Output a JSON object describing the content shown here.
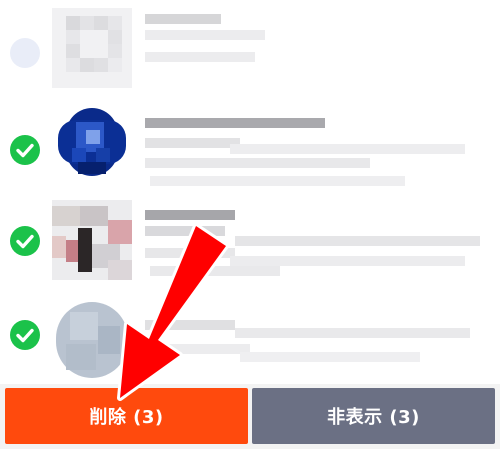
{
  "rows": [
    {
      "selected": false
    },
    {
      "selected": true
    },
    {
      "selected": true
    },
    {
      "selected": true
    }
  ],
  "actions": {
    "delete_label": "削除 (3)",
    "hide_label": "非表示 (3)"
  },
  "colors": {
    "delete": "#ff4a0d",
    "hide": "#6b7084",
    "check": "#1bc24a",
    "arrow": "#ff0000"
  },
  "icons": {
    "check": "checkmark-circle",
    "unchecked": "empty-circle",
    "annotation": "red-arrow"
  }
}
